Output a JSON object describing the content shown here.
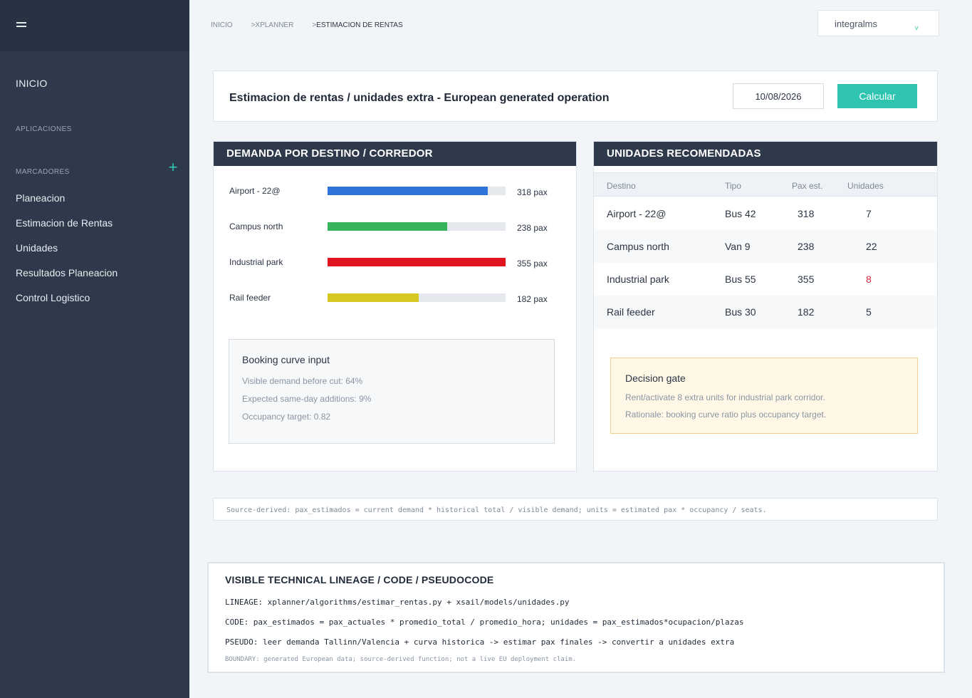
{
  "sidebar": {
    "inicio": "INICIO",
    "aplicaciones": "APLICACIONES",
    "marcadores": "MARCADORES",
    "add_icon": "plus-icon",
    "items": [
      "Planeacion",
      "Estimacion de Rentas",
      "Unidades",
      "Resultados Planeacion",
      "Control Logistico"
    ]
  },
  "breadcrumb": {
    "items": [
      "INICIO",
      "XPLANNER",
      "ESTIMACION DE RENTAS"
    ],
    "separator": ">"
  },
  "user": {
    "name": "integralms",
    "chevron": "v"
  },
  "header": {
    "title": "Estimacion de rentas / unidades extra - European generated operation",
    "date": "10/08/2026",
    "calc_label": "Calcular"
  },
  "demand": {
    "title": "DEMANDA POR DESTINO / CORREDOR",
    "max": 355,
    "rows": [
      {
        "label": "Airport - 22@",
        "pax": 318,
        "value_label": "318 pax",
        "color": "#2f74d9",
        "fill_fraction": 0.9
      },
      {
        "label": "Campus north",
        "pax": 238,
        "value_label": "238 pax",
        "color": "#36b45c",
        "fill_fraction": 0.672
      },
      {
        "label": "Industrial park",
        "pax": 355,
        "value_label": "355 pax",
        "color": "#e0141e",
        "fill_fraction": 1.0
      },
      {
        "label": "Rail feeder",
        "pax": 182,
        "value_label": "182 pax",
        "color": "#d7c722",
        "fill_fraction": 0.512
      }
    ],
    "booking": {
      "title": "Booking curve input",
      "lines": [
        "Visible demand before cut: 64%",
        "Expected same-day additions: 9%",
        "Occupancy target: 0.82"
      ]
    }
  },
  "units": {
    "title": "UNIDADES RECOMENDADAS",
    "columns": [
      "Destino",
      "Tipo",
      "Pax est.",
      "Unidades"
    ],
    "rows": [
      {
        "destino": "Airport - 22@",
        "tipo": "Bus 42",
        "pax": "318",
        "unidades": "7",
        "warn": false
      },
      {
        "destino": "Campus north",
        "tipo": "Van 9",
        "pax": "238",
        "unidades": "22",
        "warn": false
      },
      {
        "destino": "Industrial park",
        "tipo": "Bus 55",
        "pax": "355",
        "unidades": "8",
        "warn": true
      },
      {
        "destino": "Rail feeder",
        "tipo": "Bus 30",
        "pax": "182",
        "unidades": "5",
        "warn": false
      }
    ],
    "warn_color": "#d62d3a",
    "decision": {
      "title": "Decision gate",
      "lines": [
        "Rent/activate 8 extra units for industrial park corridor.",
        "Rationale: booking curve ratio plus occupancy target."
      ]
    }
  },
  "formula": "Source-derived: pax_estimados = current demand * historical total / visible demand; units = estimated pax * occupancy / seats.",
  "lineage": {
    "title": "VISIBLE TECHNICAL LINEAGE / CODE / PSEUDOCODE",
    "lineage": "LINEAGE: xplanner/algorithms/estimar_rentas.py + xsail/models/unidades.py",
    "code": "CODE: pax_estimados = pax_actuales * promedio_total / promedio_hora; unidades = pax_estimados*ocupacion/plazas",
    "pseudo": "PSEUDO: leer demanda Tallinn/Valencia + curva historica -> estimar pax finales -> convertir a unidades extra",
    "boundary": "BOUNDARY: generated European data; source-derived function; not a live EU deployment claim."
  },
  "colors": {
    "accent": "#2ec4b0",
    "sidebar": "#2e3a4b",
    "panel_head": "#2e3a4b"
  }
}
